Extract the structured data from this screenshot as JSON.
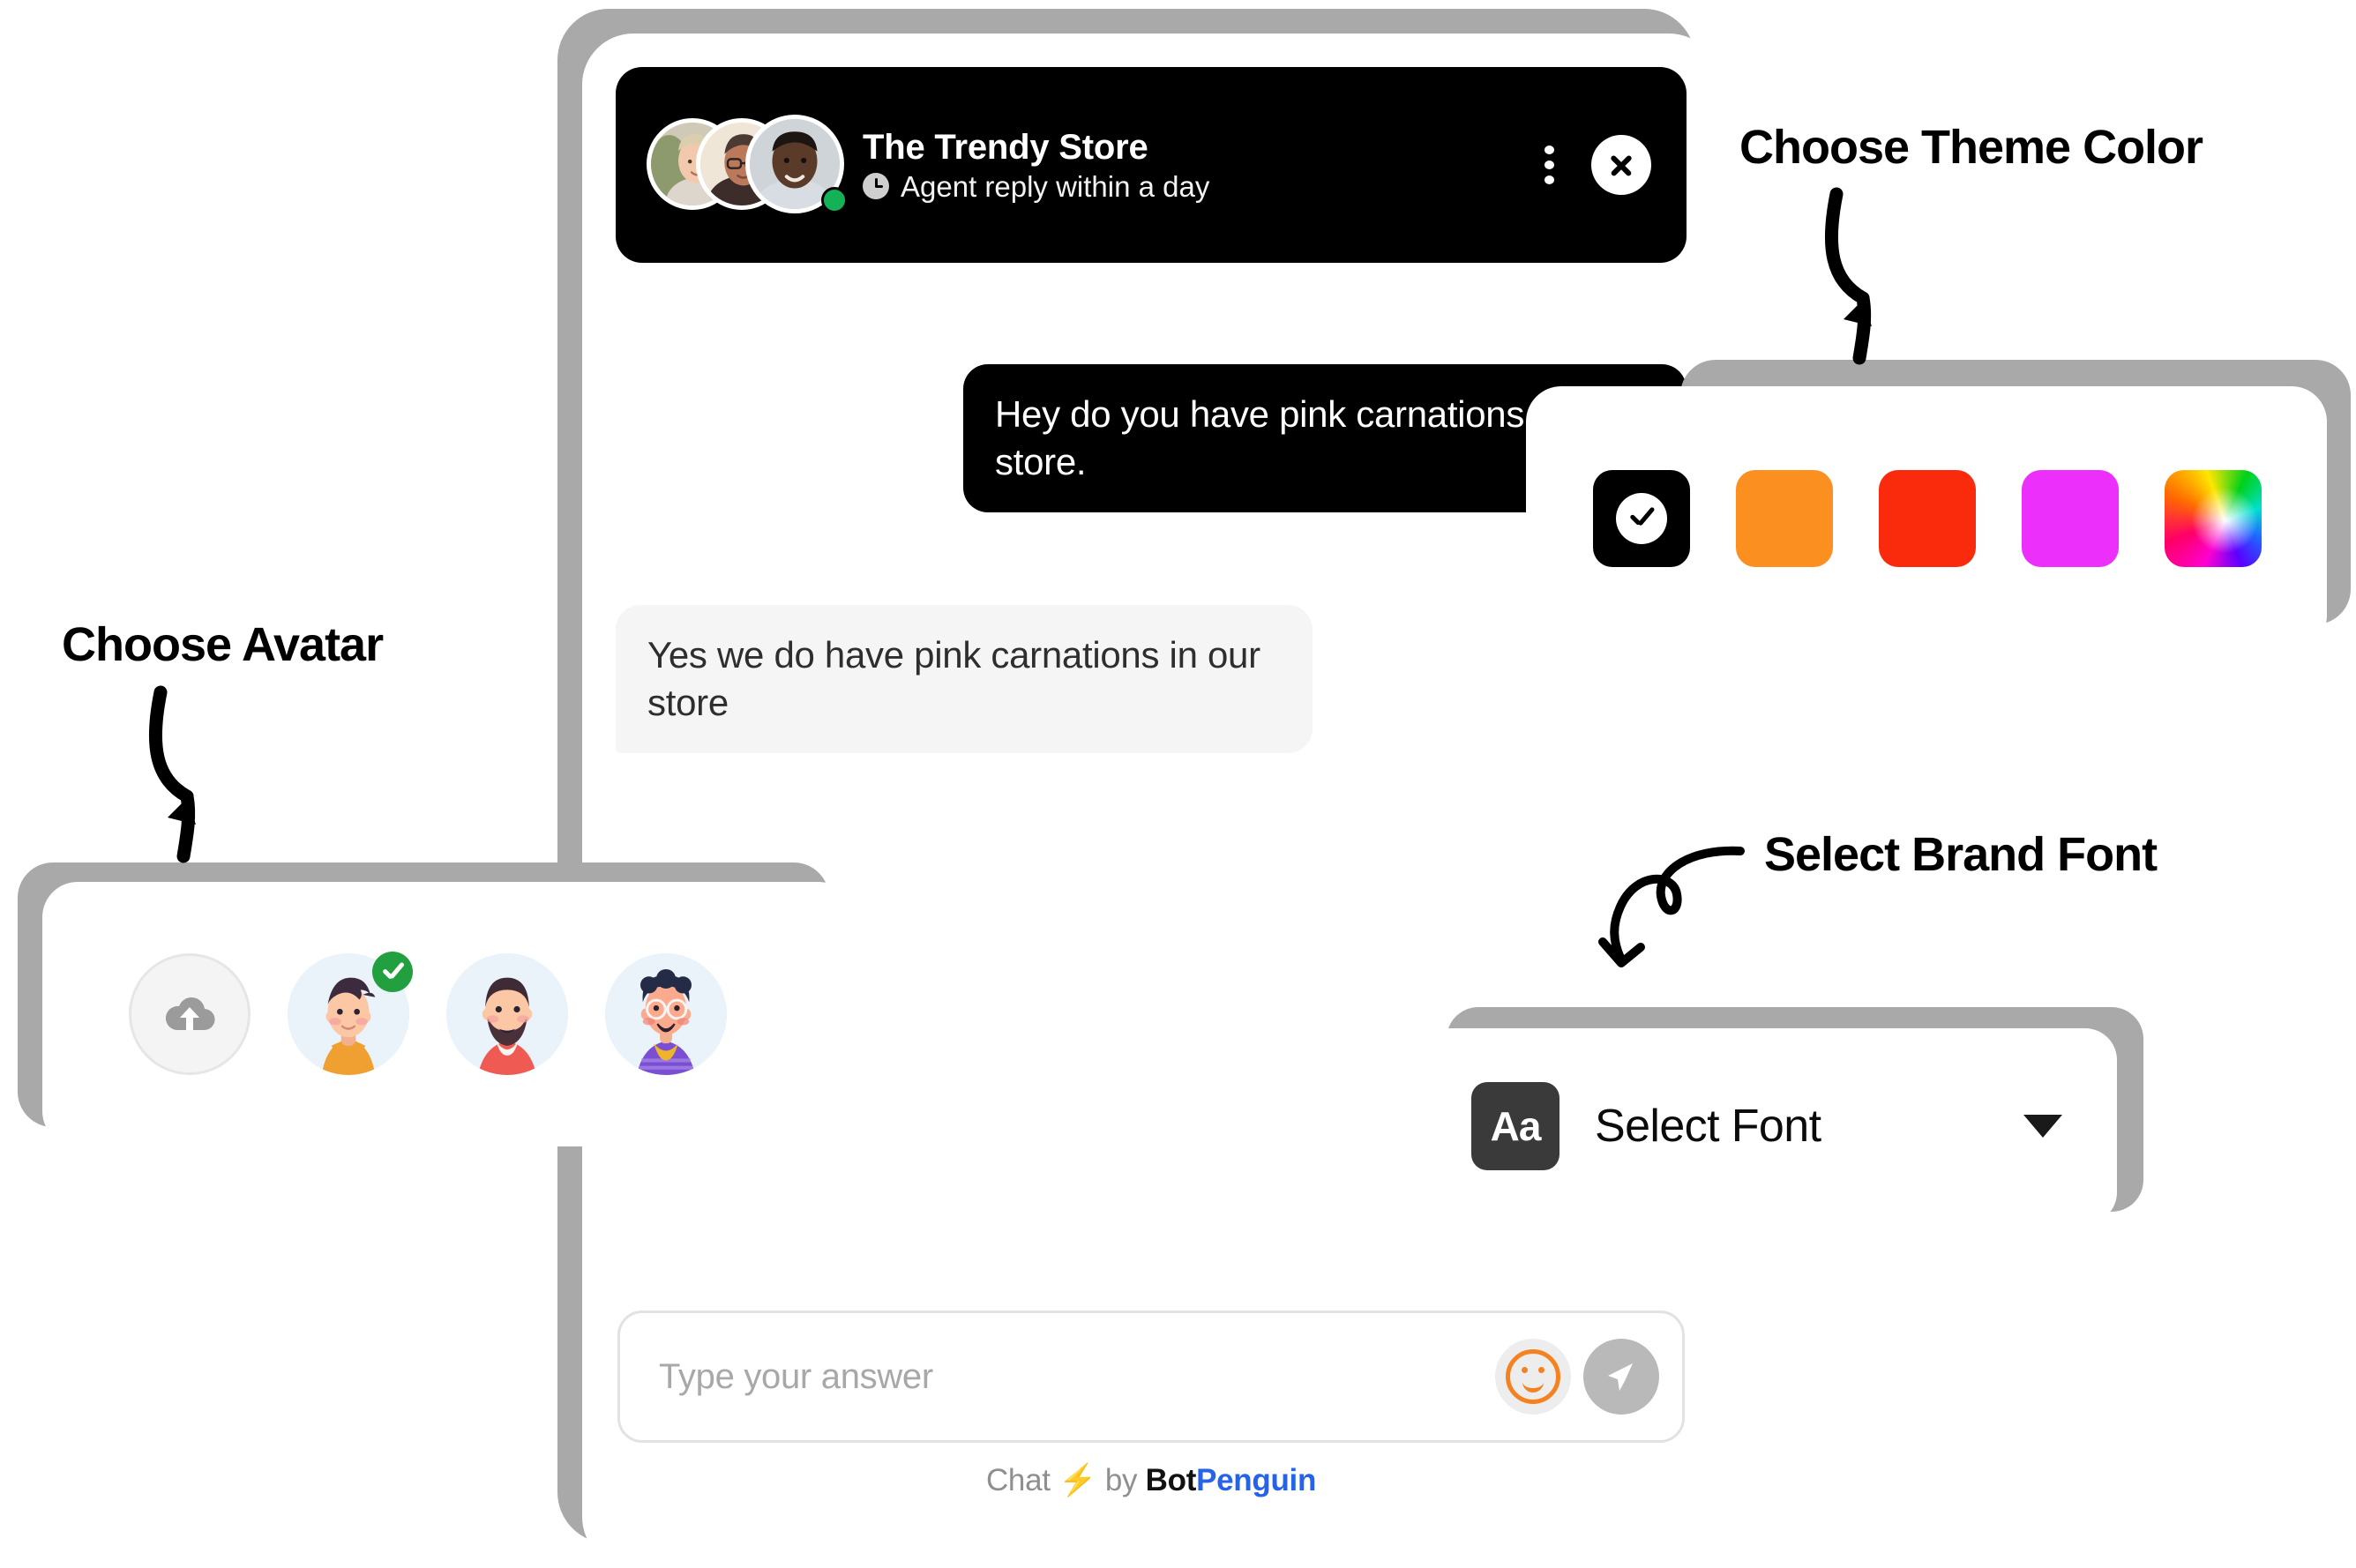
{
  "widget": {
    "header": {
      "store_name": "The Trendy Store",
      "reply_time": "Agent reply within a day",
      "clock_icon": "clock-icon",
      "menu_icon": "kebab-menu-icon",
      "close_icon": "close-icon",
      "online_status": "online"
    },
    "messages": [
      {
        "role": "user",
        "text": "Hey do you have pink carnations in our store."
      },
      {
        "role": "bot",
        "text": "Yes we do have pink carnations in our store"
      }
    ],
    "composer": {
      "placeholder": "Type your answer",
      "value": "",
      "emoji_icon": "smiley-icon",
      "send_icon": "send-paper-plane-icon"
    },
    "footer": {
      "chat": "Chat",
      "bolt": "⚡",
      "by": "by",
      "brand_first": "Bot",
      "brand_second": "Penguin"
    }
  },
  "annotations": {
    "theme": "Choose Theme Color",
    "avatar": "Choose Avatar",
    "font": "Select Brand Font"
  },
  "theme_panel": {
    "name": "choose-theme-color",
    "swatches": [
      {
        "name": "black-selected",
        "color": "#000000",
        "selected": true
      },
      {
        "name": "orange",
        "color": "#fb9021",
        "selected": false
      },
      {
        "name": "red",
        "color": "#fa2b0c",
        "selected": false
      },
      {
        "name": "magenta",
        "color": "#ec2ffb",
        "selected": false
      },
      {
        "name": "custom-rainbow",
        "color": "rainbow",
        "selected": false
      }
    ]
  },
  "avatar_panel": {
    "name": "choose-avatar",
    "options": [
      {
        "name": "upload",
        "icon": "cloud-upload-icon",
        "selected": false
      },
      {
        "name": "avatar-orange-hoodie",
        "selected": true
      },
      {
        "name": "avatar-bearded-red-shirt",
        "selected": false
      },
      {
        "name": "avatar-glasses-purple-shirt",
        "selected": false
      }
    ]
  },
  "font_panel": {
    "badge": "Aa",
    "label": "Select Font",
    "caret_icon": "chevron-down-icon"
  },
  "colors": {
    "accent_black": "#000000",
    "panel_white": "#ffffff",
    "shadow_gray": "#a9a9a9",
    "bot_bubble": "#f5f5f5",
    "online_green": "#13b257",
    "brand_blue": "#2563eb",
    "emoji_orange": "#f58220"
  }
}
